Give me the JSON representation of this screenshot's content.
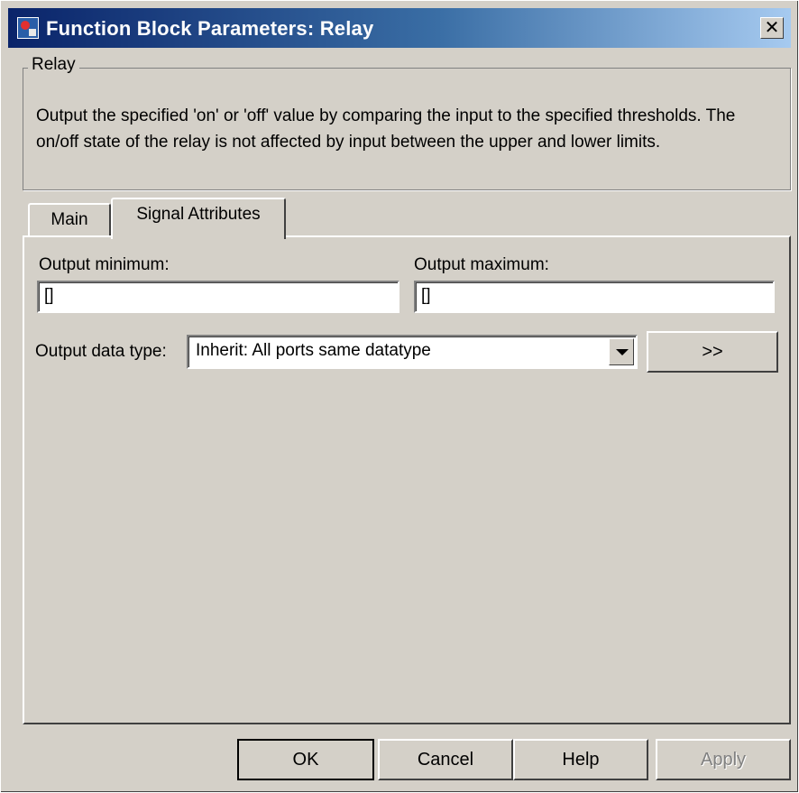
{
  "window": {
    "title": "Function Block Parameters: Relay",
    "close_glyph": "✕",
    "title_icon": "simulink-block-icon"
  },
  "description": {
    "group_label": "Relay",
    "text": "Output the specified 'on' or 'off' value by comparing the input to the specified thresholds.  The on/off state of the relay is not affected by input between the upper and lower limits."
  },
  "tabs": [
    {
      "label": "Main",
      "active": false
    },
    {
      "label": "Signal Attributes",
      "active": true
    }
  ],
  "signal_attributes": {
    "output_minimum_label": "Output minimum:",
    "output_minimum_value": "[]",
    "output_maximum_label": "Output maximum:",
    "output_maximum_value": "[]",
    "output_data_type_label": "Output data type:",
    "output_data_type_value": "Inherit: All ports same datatype",
    "data_type_assistant_label": ">>"
  },
  "buttons": {
    "ok": "OK",
    "cancel": "Cancel",
    "help": "Help",
    "apply": "Apply"
  },
  "colors": {
    "face": "#d4d0c8",
    "title_start": "#0a246a",
    "title_end": "#a6caf0",
    "disabled_text": "#808080"
  }
}
